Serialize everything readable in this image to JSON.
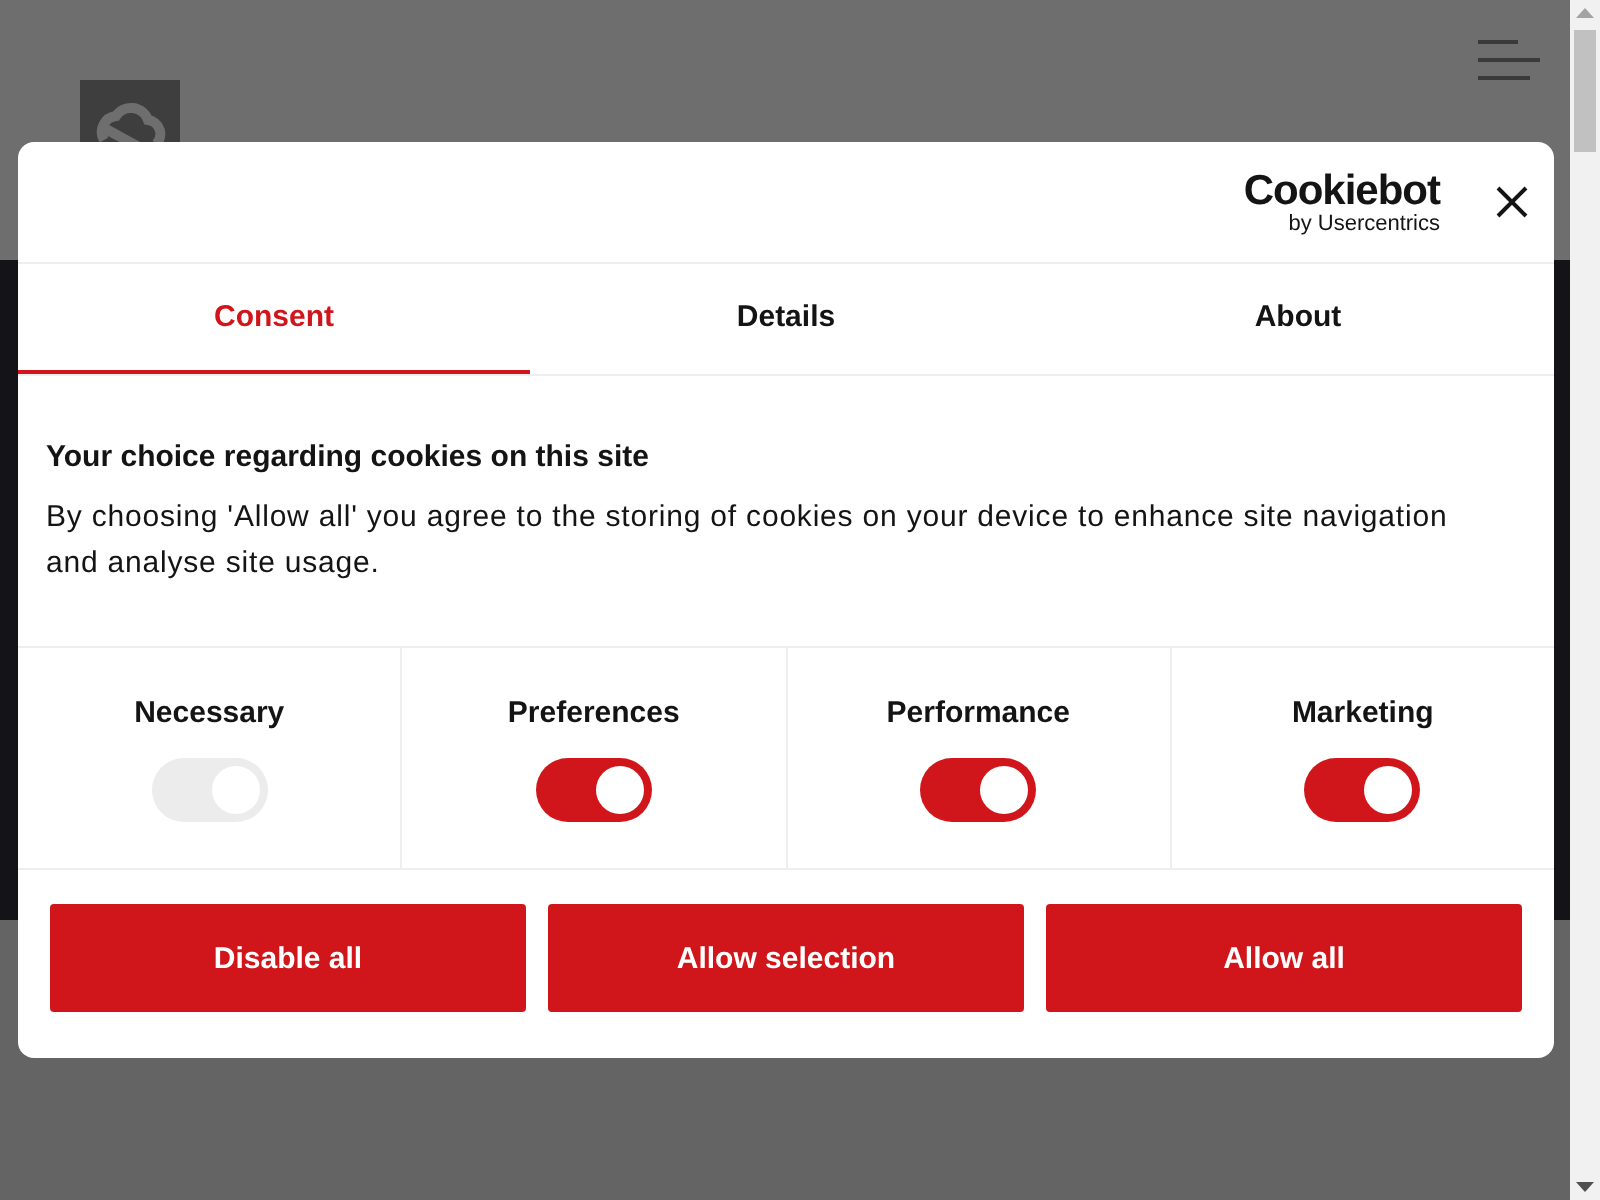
{
  "dialog": {
    "brand": {
      "name": "Cookiebot",
      "byline": "by Usercentrics"
    },
    "tabs": [
      {
        "label": "Consent",
        "selected": true
      },
      {
        "label": "Details",
        "selected": false
      },
      {
        "label": "About",
        "selected": false
      }
    ],
    "heading": "Your choice regarding cookies on this site",
    "text": "By choosing 'Allow all' you agree to the storing of cookies on your device to enhance site navigation and analyse site usage.",
    "categories": [
      {
        "label": "Necessary",
        "on": true,
        "disabled": true
      },
      {
        "label": "Preferences",
        "on": true,
        "disabled": false
      },
      {
        "label": "Performance",
        "on": true,
        "disabled": false
      },
      {
        "label": "Marketing",
        "on": true,
        "disabled": false
      }
    ],
    "buttons": [
      "Disable all",
      "Allow selection",
      "Allow all"
    ]
  }
}
